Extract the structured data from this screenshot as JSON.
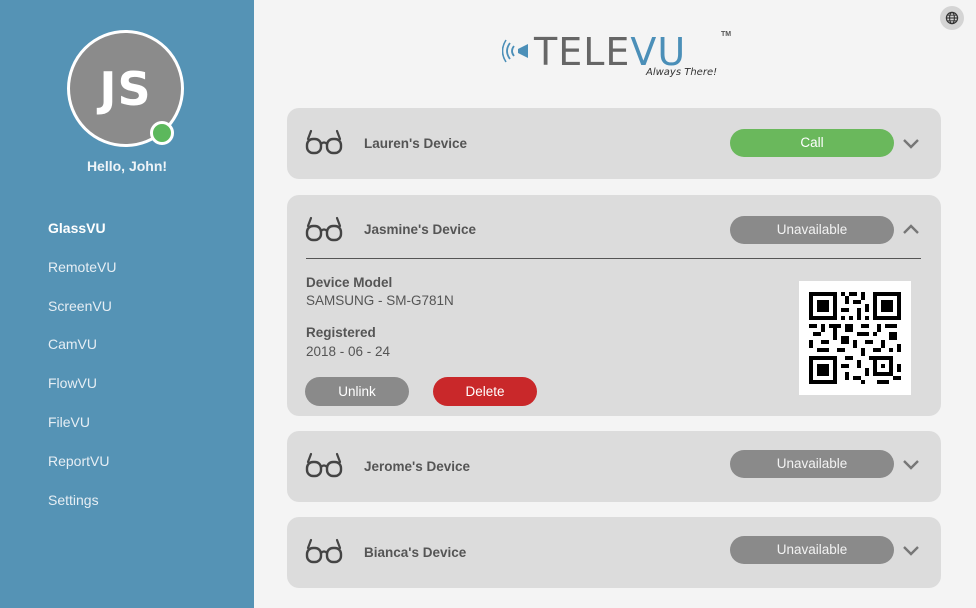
{
  "sidebar": {
    "initials": "JS",
    "greeting": "Hello, John!",
    "nav": [
      {
        "label": "GlassVU",
        "active": true
      },
      {
        "label": "RemoteVU"
      },
      {
        "label": "ScreenVU"
      },
      {
        "label": "CamVU"
      },
      {
        "label": "FlowVU"
      },
      {
        "label": "FileVU"
      },
      {
        "label": "ReportVU"
      },
      {
        "label": "Settings"
      }
    ]
  },
  "header": {
    "logo_tele": "TELE",
    "logo_vu": "VU",
    "logo_tm": "TM",
    "logo_tagline": "Always There!"
  },
  "devices": [
    {
      "name": "Lauren's Device",
      "status": "Call",
      "expanded": false
    },
    {
      "name": "Jasmine's Device",
      "status": "Unavailable",
      "expanded": true
    },
    {
      "name": "Jerome's Device",
      "status": "Unavailable",
      "expanded": false
    },
    {
      "name": "Bianca's Device",
      "status": "Unavailable",
      "expanded": false
    }
  ],
  "detail": {
    "model_label": "Device Model",
    "model_value": "SAMSUNG - SM-G781N",
    "registered_label": "Registered",
    "registered_value": "2018 - 06 - 24",
    "unlink_label": "Unlink",
    "delete_label": "Delete"
  },
  "colors": {
    "sidebar": "#5593b5",
    "call": "#6ab85c",
    "unavailable": "#8a8a8a",
    "delete": "#c9282a",
    "online": "#5cb85c"
  },
  "icons": [
    "globe-icon",
    "glasses-icon",
    "chevron-down-icon",
    "chevron-up-icon",
    "qr-code",
    "speaker-waves-icon"
  ]
}
